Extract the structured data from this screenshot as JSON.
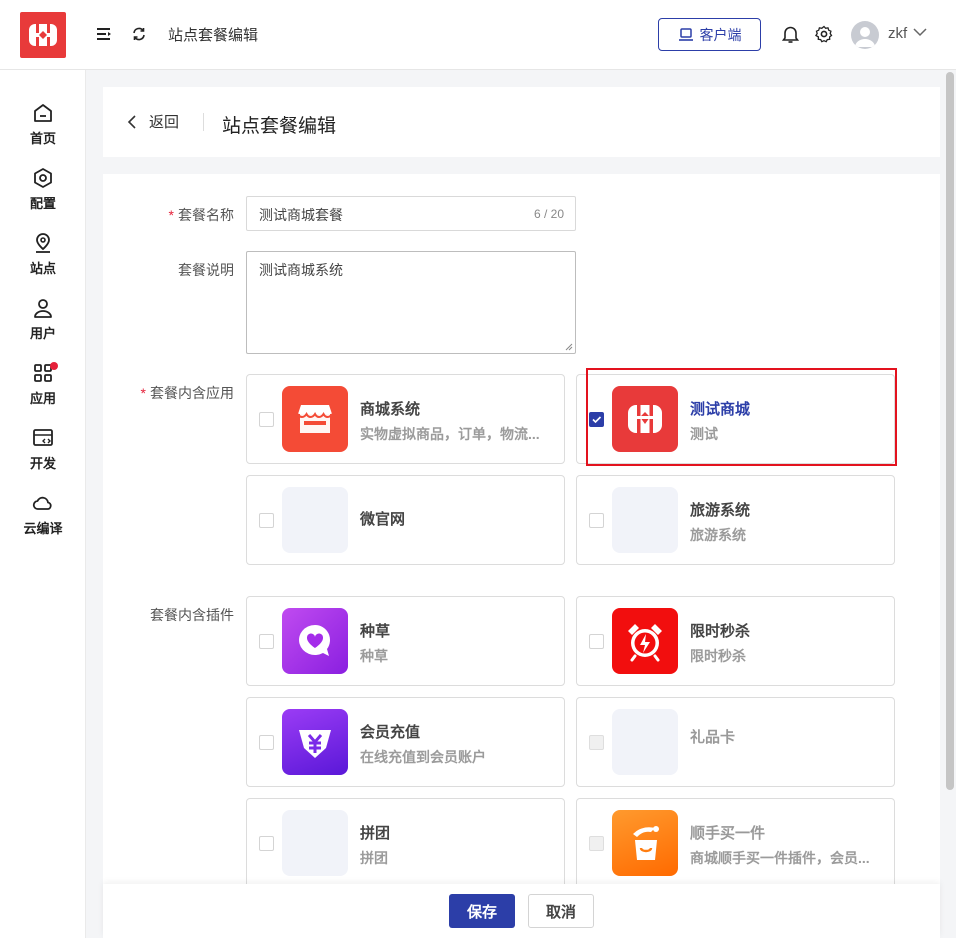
{
  "header": {
    "page_title": "站点套餐编辑",
    "client_button": "客户端",
    "username": "zkf"
  },
  "sidebar": {
    "items": [
      {
        "label": "首页",
        "icon": "home-icon"
      },
      {
        "label": "配置",
        "icon": "settings-hex-icon"
      },
      {
        "label": "站点",
        "icon": "location-pin-icon"
      },
      {
        "label": "用户",
        "icon": "user-icon"
      },
      {
        "label": "应用",
        "icon": "apps-grid-icon",
        "badge": true
      },
      {
        "label": "开发",
        "icon": "code-window-icon"
      },
      {
        "label": "云编译",
        "icon": "cloud-icon"
      }
    ]
  },
  "page": {
    "back_label": "返回",
    "title": "站点套餐编辑"
  },
  "form": {
    "name_label": "套餐名称",
    "name_value": "测试商城套餐",
    "name_counter": "6 / 20",
    "desc_label": "套餐说明",
    "desc_value": "测试商城系统",
    "apps_label": "套餐内含应用",
    "plugins_label": "套餐内含插件"
  },
  "apps": [
    {
      "title": "商城系统",
      "desc": "实物虚拟商品，订单，物流...",
      "checked": false,
      "icon": "store-icon"
    },
    {
      "title": "测试商城",
      "desc": "测试",
      "checked": true,
      "icon": "gift-icon"
    },
    {
      "title": "微官网",
      "desc": "",
      "checked": false,
      "icon": "placeholder"
    },
    {
      "title": "旅游系统",
      "desc": "旅游系统",
      "checked": false,
      "icon": "placeholder"
    }
  ],
  "plugins": [
    {
      "title": "种草",
      "desc": "种草",
      "checked": false,
      "icon": "heart-chat-icon"
    },
    {
      "title": "限时秒杀",
      "desc": "限时秒杀",
      "checked": false,
      "icon": "alarm-clock-icon"
    },
    {
      "title": "会员充值",
      "desc": "在线充值到会员账户",
      "checked": false,
      "icon": "yen-diamond-icon"
    },
    {
      "title": "礼品卡",
      "desc": "",
      "checked": false,
      "disabled": true,
      "icon": "placeholder"
    },
    {
      "title": "拼团",
      "desc": "拼团",
      "checked": false,
      "icon": "placeholder"
    },
    {
      "title": "顺手买一件",
      "desc": "商城顺手买一件插件，会员...",
      "checked": false,
      "disabled": true,
      "icon": "shopping-bag-icon"
    }
  ],
  "footer": {
    "save": "保存",
    "cancel": "取消"
  },
  "colors": {
    "primary": "#2c3ea8",
    "brand_red": "#e83a3a",
    "highlight_border": "#e3121e"
  }
}
